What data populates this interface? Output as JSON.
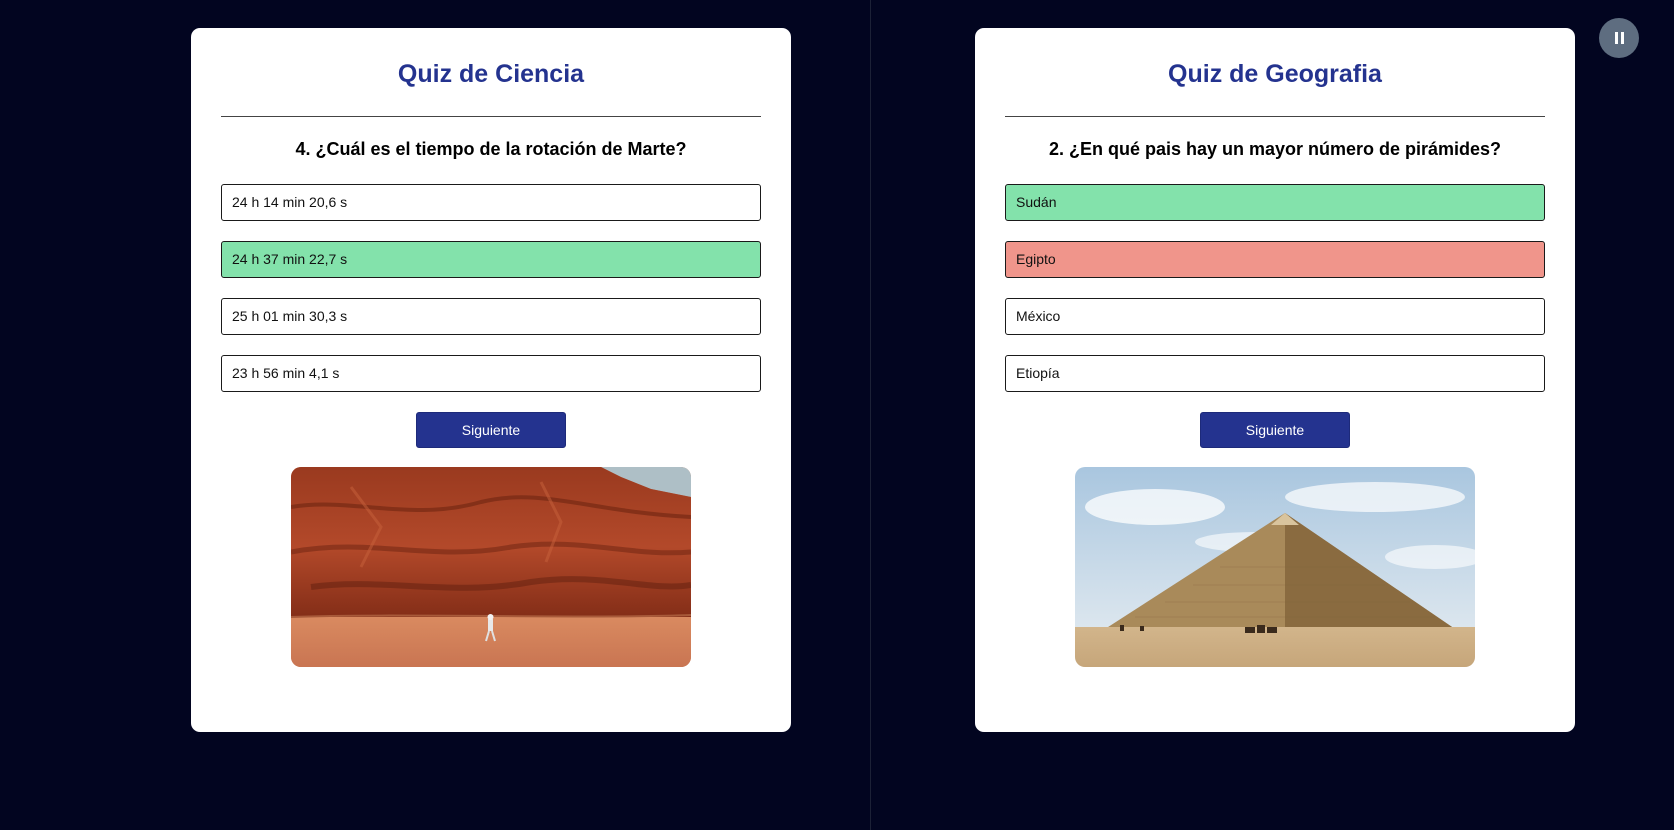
{
  "pause_button": {
    "icon": "pause-icon"
  },
  "quizzes": [
    {
      "title": "Quiz de Ciencia",
      "question": "4. ¿Cuál es el tiempo de la rotación de Marte?",
      "options": [
        {
          "label": "24 h 14 min 20,6 s",
          "state": "neutral"
        },
        {
          "label": "24 h 37 min 22,7 s",
          "state": "correct"
        },
        {
          "label": "25 h 01 min 30,3 s",
          "state": "neutral"
        },
        {
          "label": "23 h 56 min 4,1 s",
          "state": "neutral"
        }
      ],
      "next_label": "Siguiente",
      "image": "red-desert-canyon-with-astronaut"
    },
    {
      "title": "Quiz de Geografia",
      "question": "2. ¿En qué pais hay un mayor número de pirámides?",
      "options": [
        {
          "label": "Sudán",
          "state": "correct"
        },
        {
          "label": "Egipto",
          "state": "wrong"
        },
        {
          "label": "México",
          "state": "neutral"
        },
        {
          "label": "Etiopía",
          "state": "neutral"
        }
      ],
      "next_label": "Siguiente",
      "image": "great-pyramid-of-giza"
    }
  ],
  "colors": {
    "background": "#020520",
    "title": "#24338f",
    "correct": "#83e2ab",
    "wrong": "#f0958b",
    "button": "#24338f",
    "pause": "#5e6d80"
  }
}
